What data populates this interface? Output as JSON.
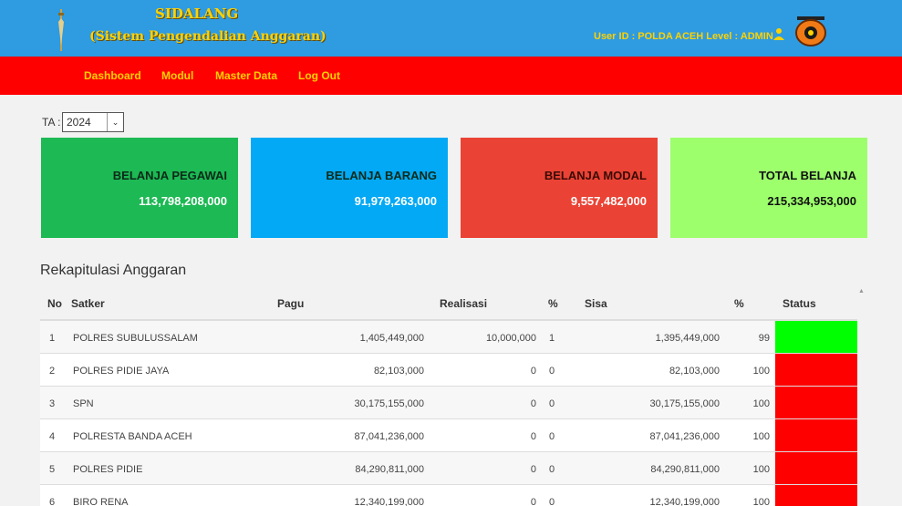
{
  "header": {
    "title_line1": "SIDALANG",
    "title_line2": "(Sistem Pengendalian Anggaran)",
    "user_info": "User ID : POLDA ACEH Level : ADMIN",
    "colors": {
      "topbar": "#2f9be0",
      "navbar": "#ff0000",
      "brand_text": "#ffd200"
    }
  },
  "nav": {
    "dashboard": "Dashboard",
    "modul": "Modul",
    "master_data": "Master Data",
    "logout": "Log Out"
  },
  "filter": {
    "label": "TA :",
    "value": "2024"
  },
  "cards": [
    {
      "title": "BELANJA PEGAWAI",
      "amount": "113,798,208,000",
      "color": "#1db954"
    },
    {
      "title": "BELANJA BARANG",
      "amount": "91,979,263,000",
      "color": "#03a9f4"
    },
    {
      "title": "BELANJA MODAL",
      "amount": "9,557,482,000",
      "color": "#ea4335"
    },
    {
      "title": "TOTAL BELANJA",
      "amount": "215,334,953,000",
      "color": "#9cff6b"
    }
  ],
  "section_title": "Rekapitulasi Anggaran",
  "table": {
    "headers": {
      "no": "No",
      "satker": "Satker",
      "pagu": "Pagu",
      "realisasi": "Realisasi",
      "pct1": "%",
      "sisa": "Sisa",
      "pct2": "%",
      "status": "Status"
    },
    "rows": [
      {
        "no": "1",
        "satker": "POLRES SUBULUSSALAM",
        "pagu": "1,405,449,000",
        "realisasi": "10,000,000",
        "pct1": "1",
        "sisa": "1,395,449,000",
        "pct2": "99",
        "status_color": "#00ff00"
      },
      {
        "no": "2",
        "satker": "POLRES PIDIE JAYA",
        "pagu": "82,103,000",
        "realisasi": "0",
        "pct1": "0",
        "sisa": "82,103,000",
        "pct2": "100",
        "status_color": "#ff0000"
      },
      {
        "no": "3",
        "satker": "SPN",
        "pagu": "30,175,155,000",
        "realisasi": "0",
        "pct1": "0",
        "sisa": "30,175,155,000",
        "pct2": "100",
        "status_color": "#ff0000"
      },
      {
        "no": "4",
        "satker": "POLRESTA BANDA ACEH",
        "pagu": "87,041,236,000",
        "realisasi": "0",
        "pct1": "0",
        "sisa": "87,041,236,000",
        "pct2": "100",
        "status_color": "#ff0000"
      },
      {
        "no": "5",
        "satker": "POLRES PIDIE",
        "pagu": "84,290,811,000",
        "realisasi": "0",
        "pct1": "0",
        "sisa": "84,290,811,000",
        "pct2": "100",
        "status_color": "#ff0000"
      },
      {
        "no": "6",
        "satker": "BIRO RENA",
        "pagu": "12,340,199,000",
        "realisasi": "0",
        "pct1": "0",
        "sisa": "12,340,199,000",
        "pct2": "100",
        "status_color": "#ff0000"
      }
    ]
  }
}
